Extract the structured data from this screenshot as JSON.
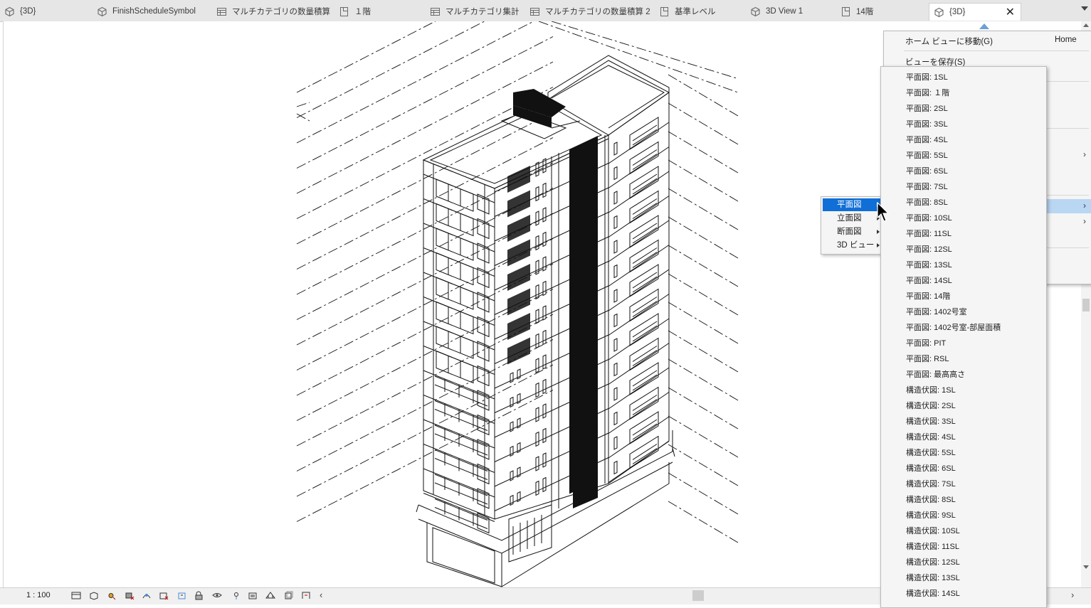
{
  "tabs": [
    {
      "label": "{3D}",
      "icon": "3d-view-icon"
    },
    {
      "label": "FinishScheduleSymbol",
      "icon": "3d-view-icon"
    },
    {
      "label": "マルチカテゴリの数量積算",
      "icon": "schedule-icon"
    },
    {
      "label": "１階",
      "icon": "plan-icon"
    },
    {
      "label": "マルチカテゴリ集計",
      "icon": "schedule-icon"
    },
    {
      "label": "マルチカテゴリの数量積算 2",
      "icon": "schedule-icon"
    },
    {
      "label": "基準レベル",
      "icon": "plan-icon"
    },
    {
      "label": "3D View 1",
      "icon": "3d-view-icon"
    },
    {
      "label": "14階",
      "icon": "plan-icon"
    },
    {
      "label": "{3D}",
      "icon": "3d-view-icon",
      "active": true
    }
  ],
  "context_menu": {
    "home": "ホーム ビューに移動(G)",
    "home_shortcut": "Home",
    "save_view": "ビューを保存(S)"
  },
  "submenu": {
    "items": [
      "平面図",
      "立面図",
      "断面図",
      "3D ビュー"
    ],
    "active_index": 0
  },
  "view_list": [
    "平面図: 1SL",
    "平面図: １階",
    "平面図: 2SL",
    "平面図: 3SL",
    "平面図: 4SL",
    "平面図: 5SL",
    "平面図: 6SL",
    "平面図: 7SL",
    "平面図: 8SL",
    "平面図: 10SL",
    "平面図: 11SL",
    "平面図: 12SL",
    "平面図: 13SL",
    "平面図: 14SL",
    "平面図: 14階",
    "平面図: 1402号室",
    "平面図: 1402号室-部屋面積",
    "平面図: PIT",
    "平面図: RSL",
    "平面図: 最高高さ",
    "構造伏図: 1SL",
    "構造伏図: 2SL",
    "構造伏図: 3SL",
    "構造伏図: 4SL",
    "構造伏図: 5SL",
    "構造伏図: 6SL",
    "構造伏図: 7SL",
    "構造伏図: 8SL",
    "構造伏図: 9SL",
    "構造伏図: 10SL",
    "構造伏図: 11SL",
    "構造伏図: 12SL",
    "構造伏図: 13SL",
    "構造伏図: 14SL"
  ],
  "view_control_bar": {
    "scale": "1 : 100",
    "icons": [
      "detail-level-icon",
      "visual-style-icon",
      "sun-path-icon",
      "shadows-icon",
      "render-icon",
      "crop-view-icon",
      "show-crop-icon",
      "unlock-3d-icon",
      "temporary-hide-icon",
      "reveal-hidden-icon",
      "temp-properties-icon",
      "analytical-model-icon",
      "highlight-displacement-icon",
      "constraints-icon"
    ]
  },
  "colors": {
    "menu_highlight": "#0f6fd6",
    "menu_hover": "#b9d6f3",
    "tabbar": "#e6e6e6"
  }
}
